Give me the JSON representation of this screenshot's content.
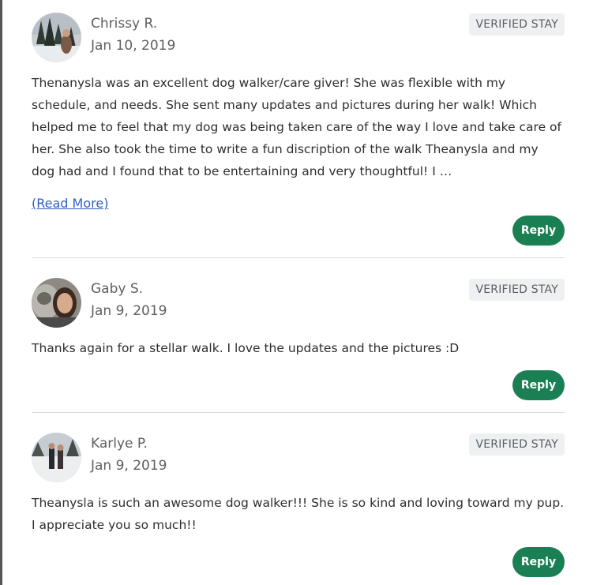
{
  "colors": {
    "reply_button": "#1b7f54",
    "badge_background": "#eef0f2",
    "link": "#2f5fc4",
    "divider": "#d9d9d9"
  },
  "reviews": [
    {
      "reviewer": "Chrissy R.",
      "date": "Jan 10, 2019",
      "badge": "VERIFIED STAY",
      "text": "Thenanysla was an excellent dog walker/care giver! She was flexible with my schedule, and needs. She sent many updates and pictures during her walk! Which helped me to feel that my dog was being taken care of the way I love and take care of her. She also took the time to write a fun discription of the walk Theanysla and my dog had and I found that to be entertaining and very thoughtful! I …",
      "read_more": "(Read More)",
      "reply": "Reply"
    },
    {
      "reviewer": "Gaby S.",
      "date": "Jan 9, 2019",
      "badge": "VERIFIED STAY",
      "text": "Thanks again for a stellar walk. I love the updates and the pictures :D",
      "reply": "Reply"
    },
    {
      "reviewer": "Karlye P.",
      "date": "Jan 9, 2019",
      "badge": "VERIFIED STAY",
      "text": "Theanysla is such an awesome dog walker!!! She is so kind and loving toward my pup. I appreciate you so much!!",
      "reply": "Reply"
    }
  ]
}
